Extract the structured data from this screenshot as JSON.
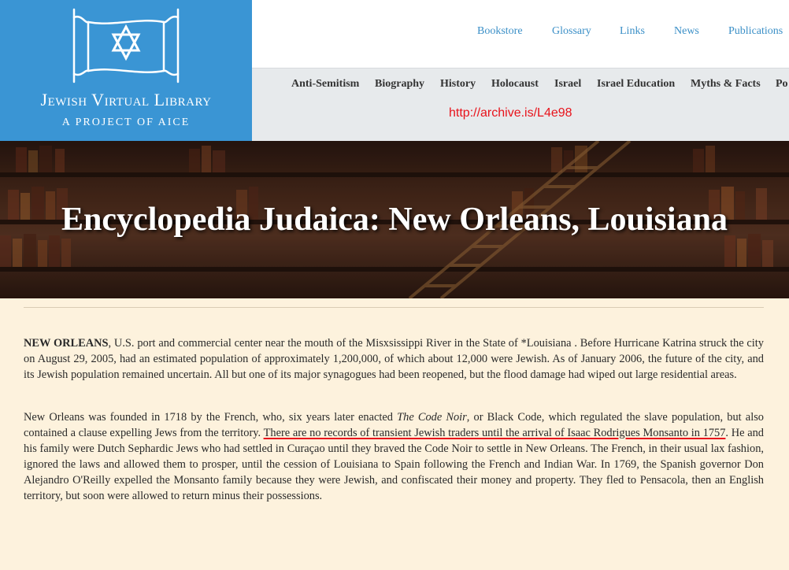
{
  "logo": {
    "brand_name": "Jewish Virtual Library",
    "tagline": "A PROJECT OF AICE",
    "icon": "torah-scroll-star-of-david-icon",
    "bg_color": "#3a95d4"
  },
  "top_nav": {
    "items": [
      "Bookstore",
      "Glossary",
      "Links",
      "News",
      "Publications"
    ],
    "link_color": "#3a8fc7"
  },
  "main_nav": {
    "items": [
      "Anti-Semitism",
      "Biography",
      "History",
      "Holocaust",
      "Israel",
      "Israel Education",
      "Myths & Facts",
      "Po"
    ]
  },
  "archive_url": "http://archive.is/L4e98",
  "hero": {
    "title": "Encyclopedia Judaica: New Orleans, Louisiana"
  },
  "article": {
    "para1": {
      "lead": "NEW ORLEANS",
      "text": ", U.S. port and commercial center near the mouth of the Misxsissippi River in the State of *Louisiana . Before Hurricane Katrina struck the city on August 29, 2005, had an estimated population of approximately 1,200,000, of which about 12,000 were Jewish. As of January 2006, the future of the city, and its Jewish population remained uncertain. All but one of its major synagogues had been reopened, but the flood damage had wiped out large residential areas."
    },
    "para2": {
      "part1": "New Orleans was founded in 1718 by the French, who, six years later enacted ",
      "italic": "The Code Noir",
      "part2": ", or Black Code, which regulated the slave population, but also contained a clause expelling Jews from the territory. ",
      "highlight": "There are no records of transient Jewish traders until the arrival of Isaac Rodrigues Monsanto in 1757",
      "part3": ". He and his family were Dutch Sephardic Jews who had settled in Curaçao until they braved the Code Noir to settle in New Orleans. The French, in their usual lax fashion, ignored the laws and allowed them to prosper, until the cession of Louisiana to Spain following the French and Indian War. In 1769, the Spanish governor Don Alejandro O'Reilly expelled the Monsanto family because they were Jewish, and confiscated their money and property. They fled to Pensacola, then an English territory, but soon were allowed to return minus their possessions."
    }
  }
}
